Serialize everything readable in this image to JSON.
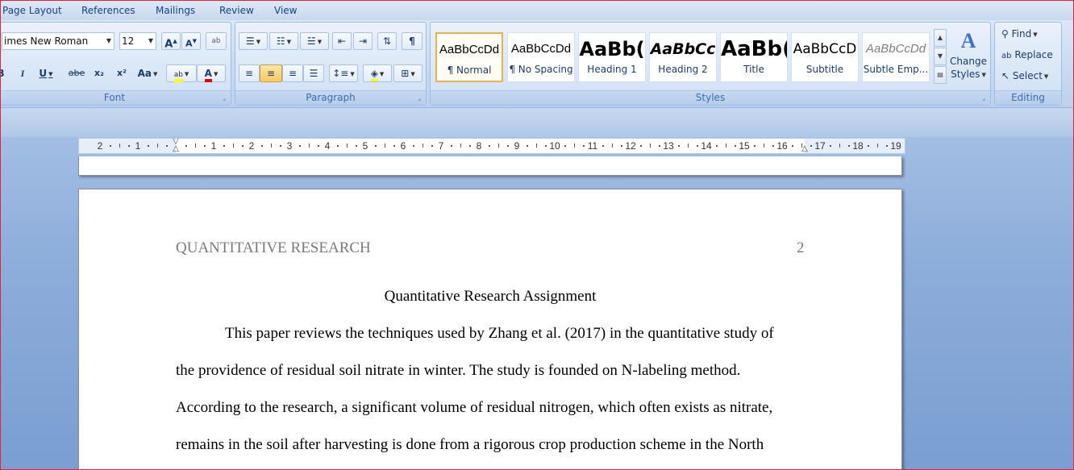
{
  "tabs": [
    "Page Layout",
    "References",
    "Mailings",
    "Review",
    "View"
  ],
  "font": {
    "name": "imes New Roman",
    "size": "12",
    "grow": "A",
    "shrink": "A",
    "clear": "ab",
    "bold": "B",
    "italic": "I",
    "underline": "U",
    "strike": "abe",
    "subscript": "x₂",
    "superscript": "x²",
    "case": "Aa",
    "highlight": "ab",
    "color": "A",
    "label": "Font"
  },
  "paragraph": {
    "label": "Paragraph",
    "pilcrow": "¶"
  },
  "styles": {
    "label": "Styles",
    "items": [
      {
        "sample": "AaBbCcDd",
        "name": "¶ Normal"
      },
      {
        "sample": "AaBbCcDd",
        "name": "¶ No Spacing"
      },
      {
        "sample": "AaBb(",
        "name": "Heading 1"
      },
      {
        "sample": "AaBbCc",
        "name": "Heading 2"
      },
      {
        "sample": "AaBb(",
        "name": "Title"
      },
      {
        "sample": "AaBbCcD",
        "name": "Subtitle"
      },
      {
        "sample": "AaBbCcDd",
        "name": "Subtle Emp..."
      }
    ],
    "change_line1": "Change",
    "change_line2": "Styles"
  },
  "editing": {
    "label": "Editing",
    "find": "Find",
    "replace": "Replace",
    "select": "Select"
  },
  "ruler": {
    "numbers": [
      "2",
      "1",
      "1",
      "2",
      "3",
      "4",
      "5",
      "6",
      "7",
      "8",
      "9",
      "10",
      "11",
      "12",
      "13",
      "14",
      "15",
      "16",
      "17",
      "18",
      "19"
    ]
  },
  "document": {
    "running_head": "QUANTITATIVE RESEARCH",
    "page_number": "2",
    "title": "Quantitative Research Assignment",
    "lines": [
      "This paper reviews the techniques used by Zhang et al. (2017) in the quantitative study of",
      "the providence of residual soil nitrate in winter. The study is founded on N-labeling method.",
      "According to the research, a significant volume of residual nitrogen, which often exists as nitrate,",
      "remains in the soil after harvesting is done from a rigorous crop production scheme in the North"
    ]
  },
  "colors": {
    "highlight": "#ffff00",
    "font_color": "#e00000",
    "accent": "#15428b"
  }
}
